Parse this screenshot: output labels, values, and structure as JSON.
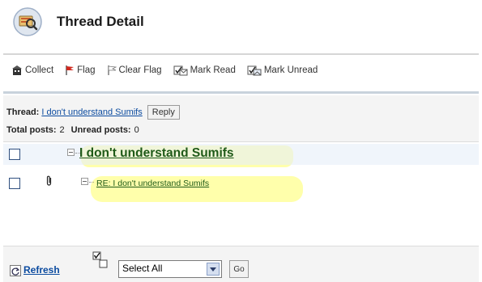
{
  "header": {
    "title": "Thread Detail",
    "icon": "thread-magnifier-icon"
  },
  "toolbar": {
    "collect_label": "Collect",
    "flag_label": "Flag",
    "clear_flag_label": "Clear Flag",
    "mark_read_label": "Mark Read",
    "mark_unread_label": "Mark Unread"
  },
  "thread_info": {
    "thread_label": "Thread:",
    "thread_title": "I don't understand Sumifs",
    "reply_label": "Reply",
    "total_posts_label": "Total posts:",
    "total_posts": "2",
    "unread_posts_label": "Unread posts:",
    "unread_posts": "0"
  },
  "messages": [
    {
      "title": "I don't understand Sumifs",
      "has_attachment": false
    },
    {
      "title": "RE: I don't understand Sumifs",
      "has_attachment": true
    }
  ],
  "footer": {
    "refresh_label": "Refresh",
    "select_value": "Select All",
    "go_label": "Go"
  },
  "colors": {
    "link_blue": "#0a4a9f",
    "message_green": "#1f5a18",
    "highlight_yellow": "#ffff66",
    "selected_row": "#e6eef9"
  }
}
